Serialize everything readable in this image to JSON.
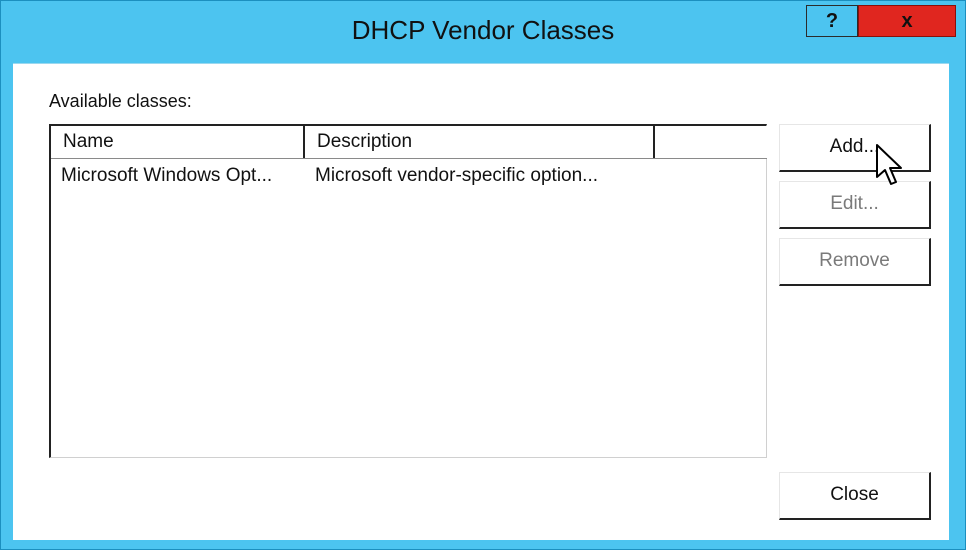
{
  "window": {
    "title": "DHCP Vendor Classes",
    "help_label": "?",
    "close_label": "x"
  },
  "available_label": "Available classes:",
  "listview": {
    "columns": [
      "Name",
      "Description",
      ""
    ],
    "rows": [
      {
        "name": "Microsoft Windows Opt...",
        "description": "Microsoft vendor-specific option..."
      }
    ]
  },
  "buttons": {
    "add": "Add...",
    "edit": "Edit...",
    "remove": "Remove",
    "close": "Close"
  },
  "colors": {
    "titlebar": "#4cc4f0",
    "close_button": "#e0261f"
  }
}
